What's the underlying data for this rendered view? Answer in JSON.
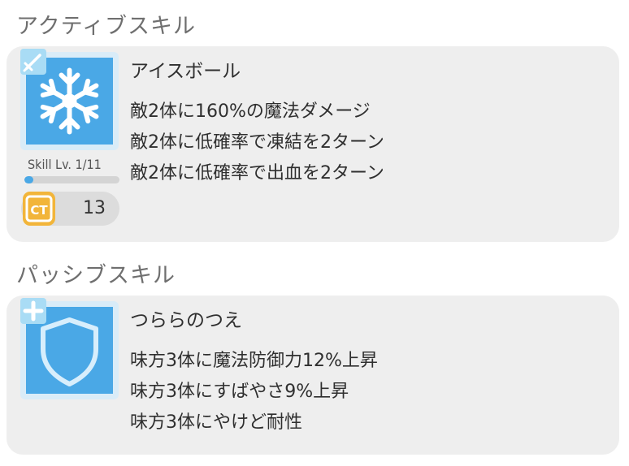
{
  "active": {
    "section_title": "アクティブスキル",
    "skill_name": "アイスボール",
    "effects": [
      "敵2体に160%の魔法ダメージ",
      "敵2体に低確率で凍結を2ターン",
      "敵2体に低確率で出血を2ターン"
    ],
    "level_label": "Skill Lv. 1/11",
    "level_fraction": 0.09,
    "ct_label": "CT",
    "ct_value": "13",
    "icon": "snowflake-icon",
    "badge_icon": "sword-icon"
  },
  "passive": {
    "section_title": "パッシブスキル",
    "skill_name": "つららのつえ",
    "effects": [
      "味方3体に魔法防御力12%上昇",
      "味方3体にすばやさ9%上昇",
      "味方3体にやけど耐性"
    ],
    "icon": "shield-icon",
    "badge_icon": "plus-icon"
  },
  "colors": {
    "icon_blue": "#4aa8e6",
    "card_bg": "#eeeeee",
    "ct_orange": "#f2b53a"
  }
}
